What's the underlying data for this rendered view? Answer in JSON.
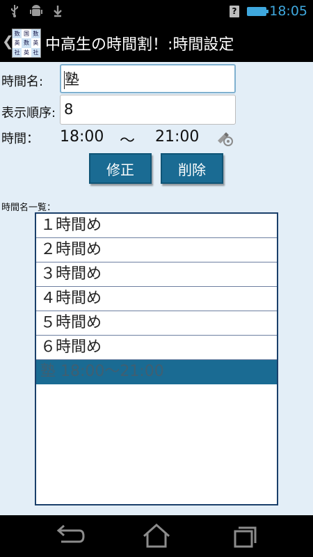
{
  "status_bar": {
    "time": "18:05",
    "icons": [
      "usb-icon",
      "android-debug-icon",
      "download-icon",
      "signal-icon",
      "battery-icon"
    ]
  },
  "action_bar": {
    "back_glyph": "❮",
    "title": "中高生の時間割！:時間設定",
    "app_icon_chars": [
      "数",
      "国",
      "数",
      "英",
      "数",
      "英",
      "社",
      "英",
      "社"
    ]
  },
  "form": {
    "name_label": "時間名:",
    "name_value": "塾",
    "order_label": "表示順序:",
    "order_value": "8",
    "time_label": "時間：",
    "start_time": "18:00",
    "separator": "〜",
    "end_time": "21:00"
  },
  "buttons": {
    "edit": "修正",
    "delete": "削除"
  },
  "list": {
    "label": "時間名一覧：",
    "items": [
      "１時間め",
      "２時間め",
      "３時間め",
      "４時間め",
      "５時間め",
      "６時間め",
      "塾 18:00〜21:00"
    ],
    "selected_index": 6
  },
  "nav_bar": {
    "icons": [
      "back-nav-icon",
      "home-nav-icon",
      "recents-nav-icon"
    ]
  },
  "colors": {
    "accent": "#1a6b93",
    "background": "#e3eef7",
    "status_time": "#3fa8de"
  }
}
